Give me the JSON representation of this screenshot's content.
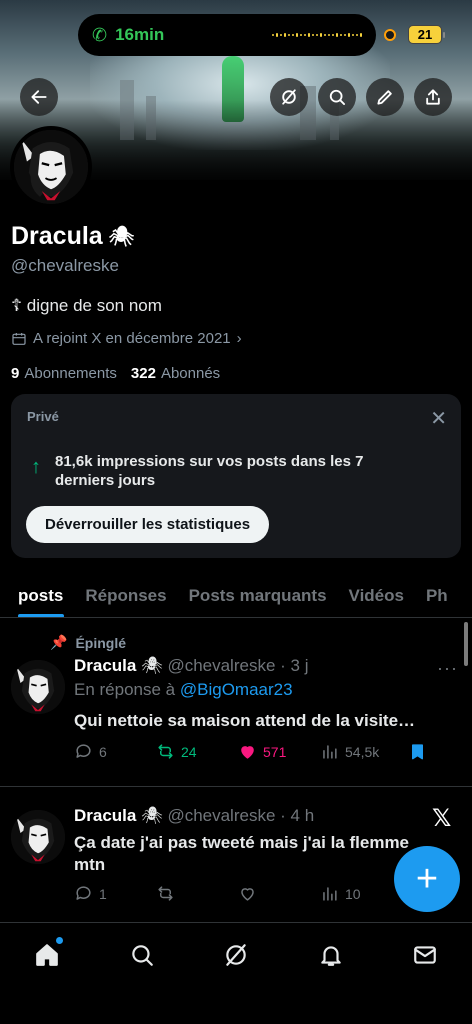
{
  "status": {
    "call_time": "16min",
    "battery": "21"
  },
  "profile": {
    "name": "Dracula",
    "spider": "🕷",
    "handle": "@chevalreske",
    "bio": "☦ digne de son nom",
    "joined": "A rejoint X en décembre 2021",
    "following_count": "9",
    "following_label": "Abonnements",
    "followers_count": "322",
    "followers_label": "Abonnés"
  },
  "private_card": {
    "label": "Privé",
    "impressions_text": "81,6k impressions sur vos posts dans les 7 derniers jours",
    "button": "Déverrouiller les statistiques"
  },
  "tabs": [
    "posts",
    "Réponses",
    "Posts marquants",
    "Vidéos",
    "Ph"
  ],
  "posts": [
    {
      "pinned_label": "Épinglé",
      "name": "Dracula",
      "handle_time": "@chevalreske · 3 j",
      "reply_prefix": "En réponse à",
      "reply_to": "@BigOmaar23",
      "text": "Qui nettoie sa maison attend de la visite…",
      "replies": "6",
      "reposts": "24",
      "likes": "571",
      "views": "54,5k",
      "more": "···"
    },
    {
      "name": "Dracula",
      "handle_time": "@chevalreske · 4 h",
      "text": "Ça date j'ai pas tweeté mais j'ai la flemme mtn",
      "replies": "1",
      "reposts": "",
      "likes": "",
      "views": "10"
    }
  ],
  "colors": {
    "accent": "#1d9bf0",
    "repost_active": "#00ba7c",
    "like_active": "#f91880"
  }
}
